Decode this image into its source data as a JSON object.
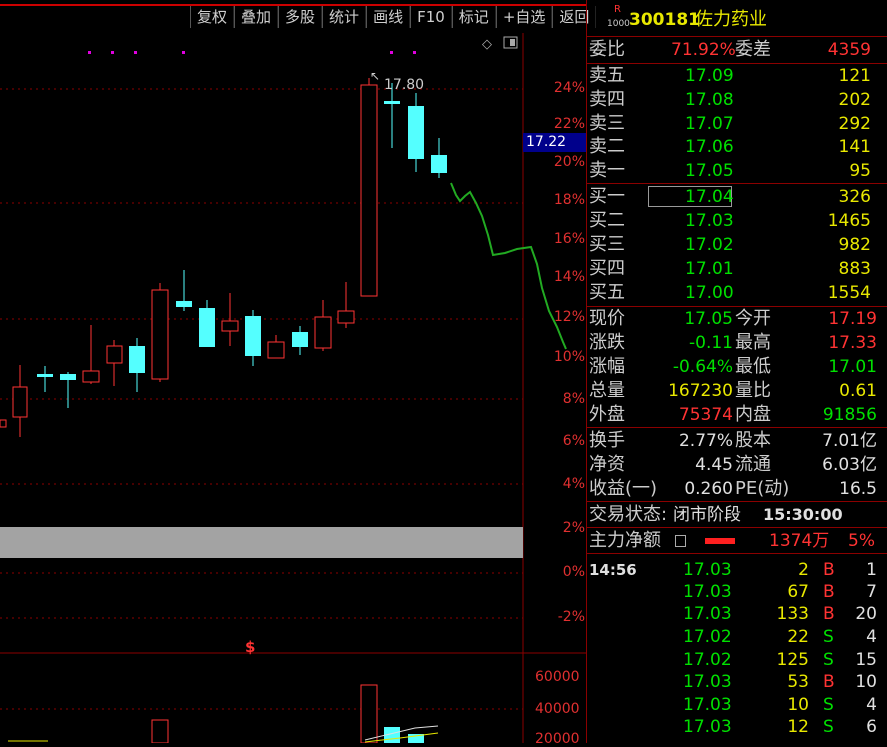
{
  "menu": [
    "复权",
    "叠加",
    "多股",
    "统计",
    "画线",
    "F10",
    "标记",
    "+自选",
    "返回"
  ],
  "chart": {
    "price_label": "17.80",
    "current_price_tag": "17.22",
    "pct_axis": [
      "24%",
      "22%",
      "20%",
      "18%",
      "16%",
      "14%",
      "12%",
      "10%",
      "8%",
      "6%",
      "4%",
      "2%",
      "0%",
      "-2%"
    ],
    "volume_axis": [
      "60000",
      "40000",
      "20000"
    ],
    "marker": "$"
  },
  "stock": {
    "badge_top": "R",
    "badge_bottom": "1000",
    "code": "300181",
    "name": "佐力药业"
  },
  "commission": {
    "ratio_label": "委比",
    "ratio": "71.92%",
    "diff_label": "委差",
    "diff": "4359"
  },
  "asks": [
    {
      "label": "卖五",
      "price": "17.09",
      "vol": "121"
    },
    {
      "label": "卖四",
      "price": "17.08",
      "vol": "202"
    },
    {
      "label": "卖三",
      "price": "17.07",
      "vol": "292"
    },
    {
      "label": "卖二",
      "price": "17.06",
      "vol": "141"
    },
    {
      "label": "卖一",
      "price": "17.05",
      "vol": "95"
    }
  ],
  "bids": [
    {
      "label": "买一",
      "price": "17.04",
      "vol": "326"
    },
    {
      "label": "买二",
      "price": "17.03",
      "vol": "1465"
    },
    {
      "label": "买三",
      "price": "17.02",
      "vol": "982"
    },
    {
      "label": "买四",
      "price": "17.01",
      "vol": "883"
    },
    {
      "label": "买五",
      "price": "17.00",
      "vol": "1554"
    }
  ],
  "quote": [
    {
      "l1": "现价",
      "v1": "17.05",
      "c1": "green",
      "l2": "今开",
      "v2": "17.19",
      "c2": "red"
    },
    {
      "l1": "涨跌",
      "v1": "-0.11",
      "c1": "green",
      "l2": "最高",
      "v2": "17.33",
      "c2": "red"
    },
    {
      "l1": "涨幅",
      "v1": "-0.64%",
      "c1": "green",
      "l2": "最低",
      "v2": "17.01",
      "c2": "green"
    },
    {
      "l1": "总量",
      "v1": "167230",
      "c1": "yellow",
      "l2": "量比",
      "v2": "0.61",
      "c2": "yellow"
    },
    {
      "l1": "外盘",
      "v1": "75374",
      "c1": "red",
      "l2": "内盘",
      "v2": "91856",
      "c2": "green"
    }
  ],
  "fundamentals": [
    {
      "l1": "换手",
      "v1": "2.77%",
      "l2": "股本",
      "v2": "7.01亿"
    },
    {
      "l1": "净资",
      "v1": "4.45",
      "l2": "流通",
      "v2": "6.03亿"
    },
    {
      "l1": "收益(一)",
      "v1": "0.260",
      "l2": "PE(动)",
      "v2": "16.5"
    }
  ],
  "status": {
    "label": "交易状态:",
    "value": "闭市阶段",
    "time": "15:30:00"
  },
  "mainflow": {
    "label": "主力净额",
    "amount": "1374万",
    "pct": "5%"
  },
  "ticks": {
    "time": "14:56",
    "rows": [
      {
        "price": "17.03",
        "vol": "2",
        "side": "B",
        "n": "1"
      },
      {
        "price": "17.03",
        "vol": "67",
        "side": "B",
        "n": "7"
      },
      {
        "price": "17.03",
        "vol": "133",
        "side": "B",
        "n": "20"
      },
      {
        "price": "17.02",
        "vol": "22",
        "side": "S",
        "n": "4"
      },
      {
        "price": "17.02",
        "vol": "125",
        "side": "S",
        "n": "15"
      },
      {
        "price": "17.03",
        "vol": "53",
        "side": "B",
        "n": "10"
      },
      {
        "price": "17.03",
        "vol": "10",
        "side": "S",
        "n": "4"
      },
      {
        "price": "17.03",
        "vol": "12",
        "side": "S",
        "n": "6"
      }
    ]
  }
}
